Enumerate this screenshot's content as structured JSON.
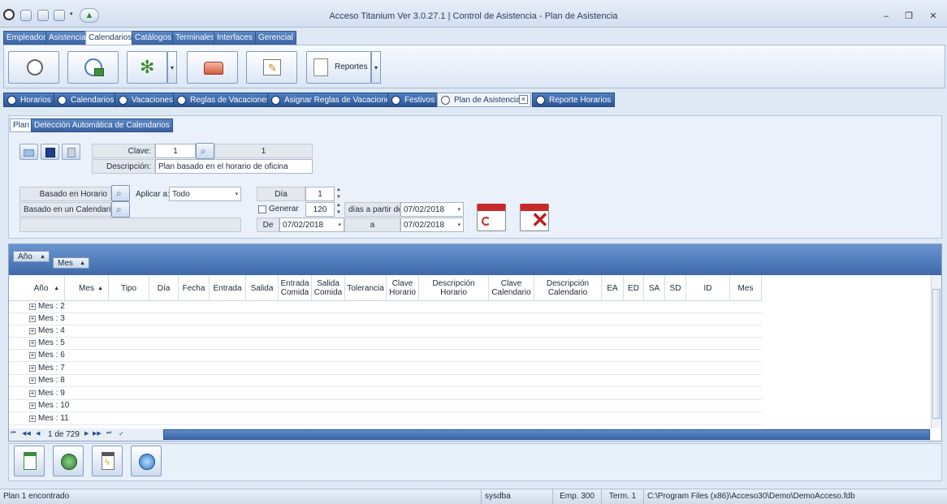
{
  "window": {
    "title": "Acceso Titanium  Ver 3.0.27.1 | Control de Asistencia - Plan de Asistencia",
    "controls": [
      "–",
      "❐",
      "✕"
    ]
  },
  "ribbon_tabs": [
    "Empleados",
    "Asistencia",
    "Calendarios",
    "Catálogos",
    "Terminales",
    "Interfaces",
    "Gerencial"
  ],
  "ribbon": {
    "reportes_label": "Reportes"
  },
  "doc_tabs": [
    "Horarios",
    "Calendarios",
    "Vacaciones",
    "Reglas de Vacaciones",
    "Asignar Reglas de Vacaciones",
    "Festivos",
    "Plan de Asistencia",
    "Reporte Horarios"
  ],
  "sub_tabs": [
    "Plan",
    "Detección Automática de Calendarios"
  ],
  "form": {
    "clave_label": "Clave:",
    "clave_value": "1",
    "clave_display": "1",
    "descripcion_label": "Descripción:",
    "descripcion_value": "Plan basado en el horario de oficina",
    "basado_horario": "Basado en Horario",
    "basado_calendario": "Basado en un Calendario",
    "aplicar_label": "Aplicar a:",
    "aplicar_value": "Todo",
    "dia_label": "Día",
    "dia_value": "1",
    "generar_label": "Generar",
    "generar_value": "120",
    "dias_label": "días a partir de",
    "dias_date": "07/02/2018",
    "de_label": "De",
    "de_date": "07/02/2018",
    "a_label": "a",
    "a_date": "07/02/2018"
  },
  "grid": {
    "group_pills": [
      "Año",
      "Mes"
    ],
    "columns": [
      "Año",
      "Mes",
      "Tipo",
      "Día",
      "Fecha",
      "Entrada",
      "Salida",
      "Entrada Comida",
      "Salida Comida",
      "Tolerancia",
      "Clave Horario",
      "Descripción Horario",
      "Clave Calendario",
      "Descripción Calendario",
      "EA",
      "ED",
      "SA",
      "SD",
      "ID",
      "Mes"
    ],
    "rows": [
      "Mes : 2",
      "Mes : 3",
      "Mes : 4",
      "Mes : 5",
      "Mes : 6",
      "Mes : 7",
      "Mes : 8",
      "Mes : 9",
      "Mes : 10",
      "Mes : 11"
    ],
    "pager": "1 de 729"
  },
  "statusbar": {
    "message": "Plan 1 encontrado",
    "user": "sysdba",
    "emp": "Emp. 300",
    "term": "Term. 1",
    "path": "C:\\Program Files (x86)\\Acceso30\\Demo\\DemoAcceso.fdb"
  }
}
